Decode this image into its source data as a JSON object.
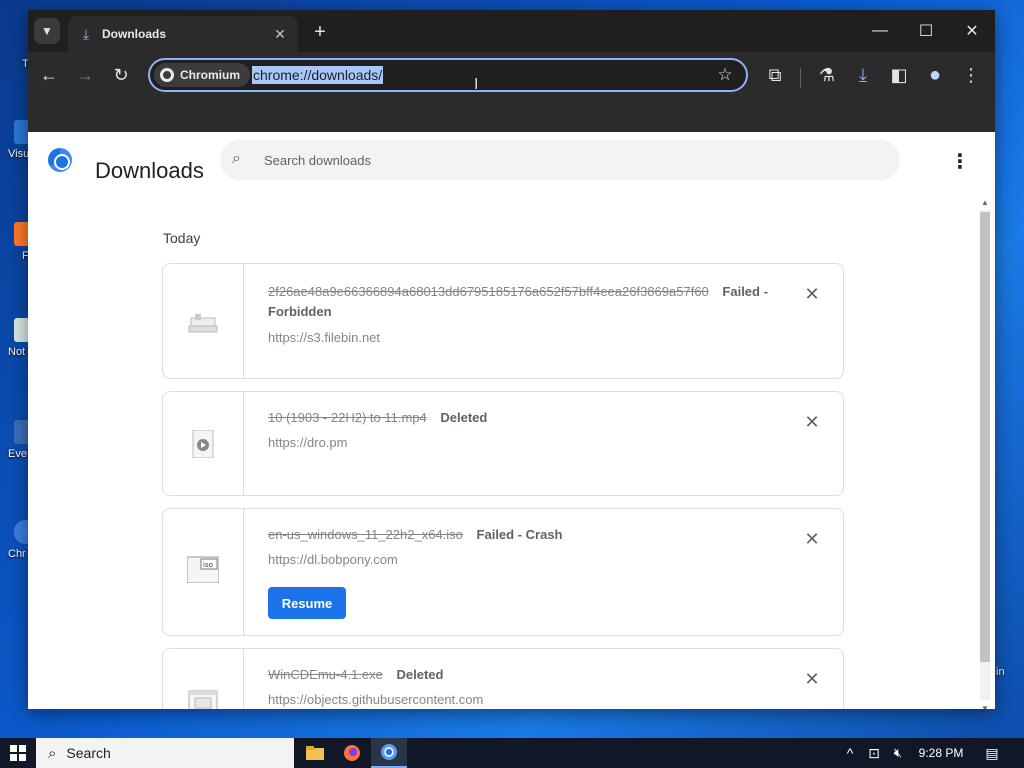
{
  "desktop": {
    "icons": [
      {
        "label": "Th"
      },
      {
        "label": "Visu"
      },
      {
        "label": "F"
      },
      {
        "label": "Not"
      },
      {
        "label": "Eve"
      },
      {
        "label": "Chr"
      },
      {
        "label": "in"
      }
    ]
  },
  "browser": {
    "tab": {
      "title": "Downloads",
      "close_glyph": "✕"
    },
    "new_tab_glyph": "+",
    "window_controls": {
      "minimize": "—",
      "maximize": "☐",
      "close": "✕"
    },
    "toolbar": {
      "back": "←",
      "forward": "→",
      "reload": "↻",
      "chip_label": "Chromium",
      "url": "chrome://downloads/",
      "star": "☆",
      "extensions": "⧉",
      "labs": "⚗",
      "downloads": "⤓",
      "sidepanel": "◧",
      "profile": "●",
      "menu": "⋮"
    }
  },
  "page": {
    "title": "Downloads",
    "search": {
      "placeholder": "Search downloads"
    },
    "menu_glyph": "⋮",
    "section_date": "Today",
    "items": [
      {
        "filename": "2f26ae48a9e66366894a68013dd6795185176a652f57bff4eea26f3869a57f60",
        "status": "Failed - Forbidden",
        "origin": "https://s3.filebin.net",
        "icon": "generic-file-icon",
        "has_resume": false
      },
      {
        "filename": "10 (1903 - 22H2) to 11.mp4",
        "status": "Deleted",
        "origin": "https://dro.pm",
        "icon": "video-file-icon",
        "has_resume": false
      },
      {
        "filename": "en-us_windows_11_22h2_x64.iso",
        "status": "Failed - Crash",
        "origin": "https://dl.bobpony.com",
        "icon": "iso-file-icon",
        "has_resume": true,
        "resume_label": "Resume"
      },
      {
        "filename": "WinCDEmu-4.1.exe",
        "status": "Deleted",
        "origin": "https://objects.githubusercontent.com",
        "icon": "exe-file-icon",
        "has_resume": false
      }
    ],
    "remove_glyph": "✕"
  },
  "taskbar": {
    "search_label": "Search",
    "clock": "9:28 PM",
    "tray": {
      "chevron": "^",
      "network": "⊡",
      "volume": "🔇︎",
      "notifications": "▤"
    }
  },
  "colors": {
    "accent": "#1a73e8",
    "omnibox_border": "#8ab4f8",
    "url_selection": "#a8c7fa",
    "titlebar": "#1f1f1f",
    "toolbar": "#2b2b2b"
  }
}
